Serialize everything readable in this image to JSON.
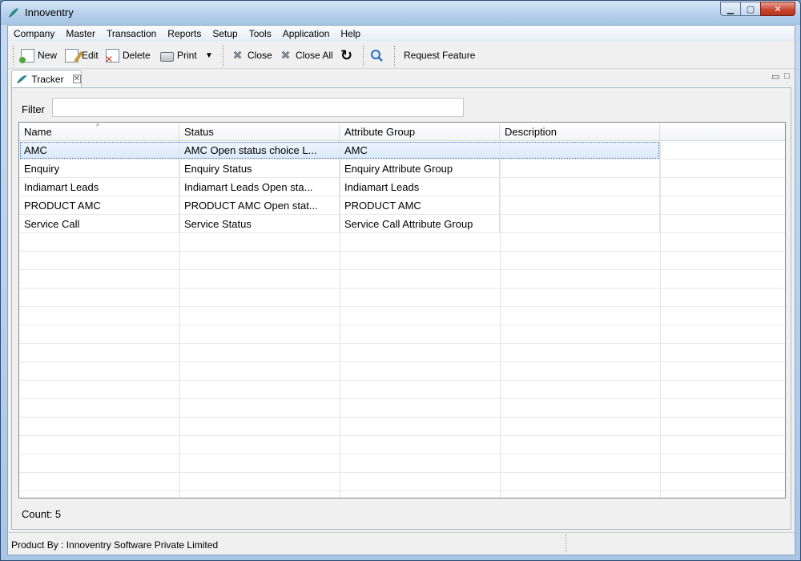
{
  "window": {
    "title": "Innoventry"
  },
  "menu": [
    "Company",
    "Master",
    "Transaction",
    "Reports",
    "Setup",
    "Tools",
    "Application",
    "Help"
  ],
  "toolbar": {
    "new_label": "New",
    "edit_label": "Edit",
    "delete_label": "Delete",
    "print_label": "Print",
    "close_label": "Close",
    "close_all_label": "Close All",
    "request_feature_label": "Request Feature"
  },
  "tab": {
    "label": "Tracker"
  },
  "filter": {
    "label": "Filter",
    "value": ""
  },
  "table": {
    "columns": [
      "Name",
      "Status",
      "Attribute Group",
      "Description"
    ],
    "sorted_column": "Name",
    "rows": [
      {
        "name": "AMC",
        "status": "AMC Open status choice L...",
        "attribute_group": "AMC",
        "description": "",
        "selected": true
      },
      {
        "name": "Enquiry",
        "status": "Enquiry Status",
        "attribute_group": "Enquiry Attribute Group",
        "description": ""
      },
      {
        "name": "Indiamart Leads",
        "status": "Indiamart Leads  Open sta...",
        "attribute_group": "Indiamart Leads",
        "description": ""
      },
      {
        "name": "PRODUCT AMC",
        "status": "PRODUCT AMC Open stat...",
        "attribute_group": "PRODUCT AMC",
        "description": ""
      },
      {
        "name": "Service Call",
        "status": "Service Status",
        "attribute_group": "Service Call Attribute Group",
        "description": ""
      }
    ]
  },
  "count": {
    "text": "Count: 5"
  },
  "status_bar": {
    "text": "Product By : Innoventry Software Private Limited"
  },
  "colors": {
    "title_bar": "#b8d1ec",
    "selection": "#d9e9fb",
    "close_button": "#c7422b"
  }
}
